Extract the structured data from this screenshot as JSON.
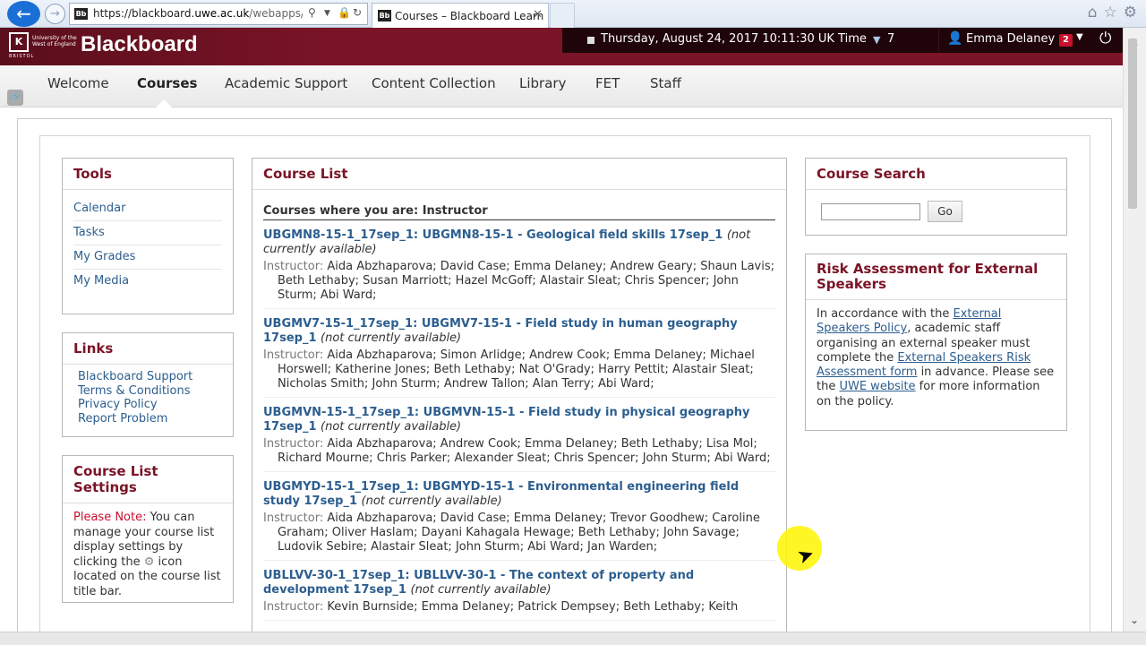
{
  "browser": {
    "url_domain_prefix": "https://blackboard.",
    "url_domain_bold": "uwe.ac.uk",
    "url_path": "/webapps/porta",
    "tab_title": "Courses – Blackboard Learn",
    "favicon_text": "Bb"
  },
  "header": {
    "brand": "Blackboard",
    "logo_text": "University of the West of England",
    "logo_sub": "BRISTOL",
    "datetime": "Thursday, August 24, 2017  10:11:30  UK Time",
    "notification_count": "7",
    "user_name": "Emma Delaney",
    "user_badge": "2"
  },
  "tabs": [
    "Welcome",
    "Courses",
    "Academic Support",
    "Content Collection",
    "Library",
    "FET",
    "Staff"
  ],
  "tools": {
    "title": "Tools",
    "items": [
      "Calendar",
      "Tasks",
      "My Grades",
      "My Media"
    ]
  },
  "links": {
    "title": "Links",
    "items": [
      "Blackboard Support",
      "Terms & Conditions",
      "Privacy Policy",
      "Report Problem"
    ]
  },
  "course_list_settings": {
    "title": "Course List Settings",
    "note_label": "Please Note:",
    "body_before_icon": " You can manage your course list display settings by clicking the ",
    "body_after_icon": " icon located on the course list title bar."
  },
  "course_list": {
    "title": "Course List",
    "subhead": "Courses where you are: Instructor",
    "instructor_label": "Instructor:",
    "courses": [
      {
        "title": "UBGMN8-15-1_17sep_1: UBGMN8-15-1 - Geological field skills 17sep_1",
        "status": "(not currently available)",
        "instructors": "Aida Abzhaparova;  David Case;  Emma Delaney;  Andrew Geary;  Shaun Lavis;  Beth Lethaby;  Susan Marriott;  Hazel McGoff;  Alastair Sleat;  Chris Spencer;  John Sturm;  Abi Ward;"
      },
      {
        "title": "UBGMV7-15-1_17sep_1: UBGMV7-15-1 - Field study in human geography 17sep_1",
        "status": "(not currently available)",
        "instructors": "Aida Abzhaparova;  Simon Arlidge;  Andrew Cook;  Emma Delaney;  Michael Horswell;  Katherine Jones;  Beth Lethaby;  Nat O'Grady;  Harry Pettit;  Alastair Sleat;  Nicholas Smith;  John Sturm;  Andrew Tallon;  Alan Terry;  Abi Ward;"
      },
      {
        "title": "UBGMVN-15-1_17sep_1: UBGMVN-15-1 - Field study in physical geography 17sep_1",
        "status": "(not currently available)",
        "instructors": "Aida Abzhaparova;  Andrew Cook;  Emma Delaney;  Beth Lethaby;  Lisa Mol;  Richard Mourne;  Chris Parker;  Alexander Sleat;  Chris Spencer;  John Sturm;  Abi Ward;"
      },
      {
        "title": "UBGMYD-15-1_17sep_1: UBGMYD-15-1 - Environmental engineering field study 17sep_1",
        "status": "(not currently available)",
        "instructors": "Aida Abzhaparova;  David Case;  Emma Delaney;  Trevor Goodhew;  Caroline Graham;  Oliver Haslam;  Dayani Kahagala Hewage;  Beth Lethaby;  John Savage;  Ludovik Sebire;  Alastair Sleat;  John Sturm;  Abi Ward;  Jan Warden;"
      },
      {
        "title": "UBLLVV-30-1_17sep_1: UBLLVV-30-1 - The context of property and development 17sep_1",
        "status": "(not currently available)",
        "instructors": "Kevin Burnside;  Emma Delaney;  Patrick Dempsey;  Beth Lethaby;  Keith"
      }
    ]
  },
  "course_search": {
    "title": "Course Search",
    "button": "Go"
  },
  "risk": {
    "title": "Risk Assessment for External Speakers",
    "t1": "In accordance with the ",
    "l1": "External Speakers Policy",
    "t2": ", academic staff organising an external speaker must complete the ",
    "l2": "External Speakers Risk Assessment form",
    "t3": " in advance. Please see the ",
    "l3": "UWE website",
    "t4": " for more information on the policy."
  }
}
